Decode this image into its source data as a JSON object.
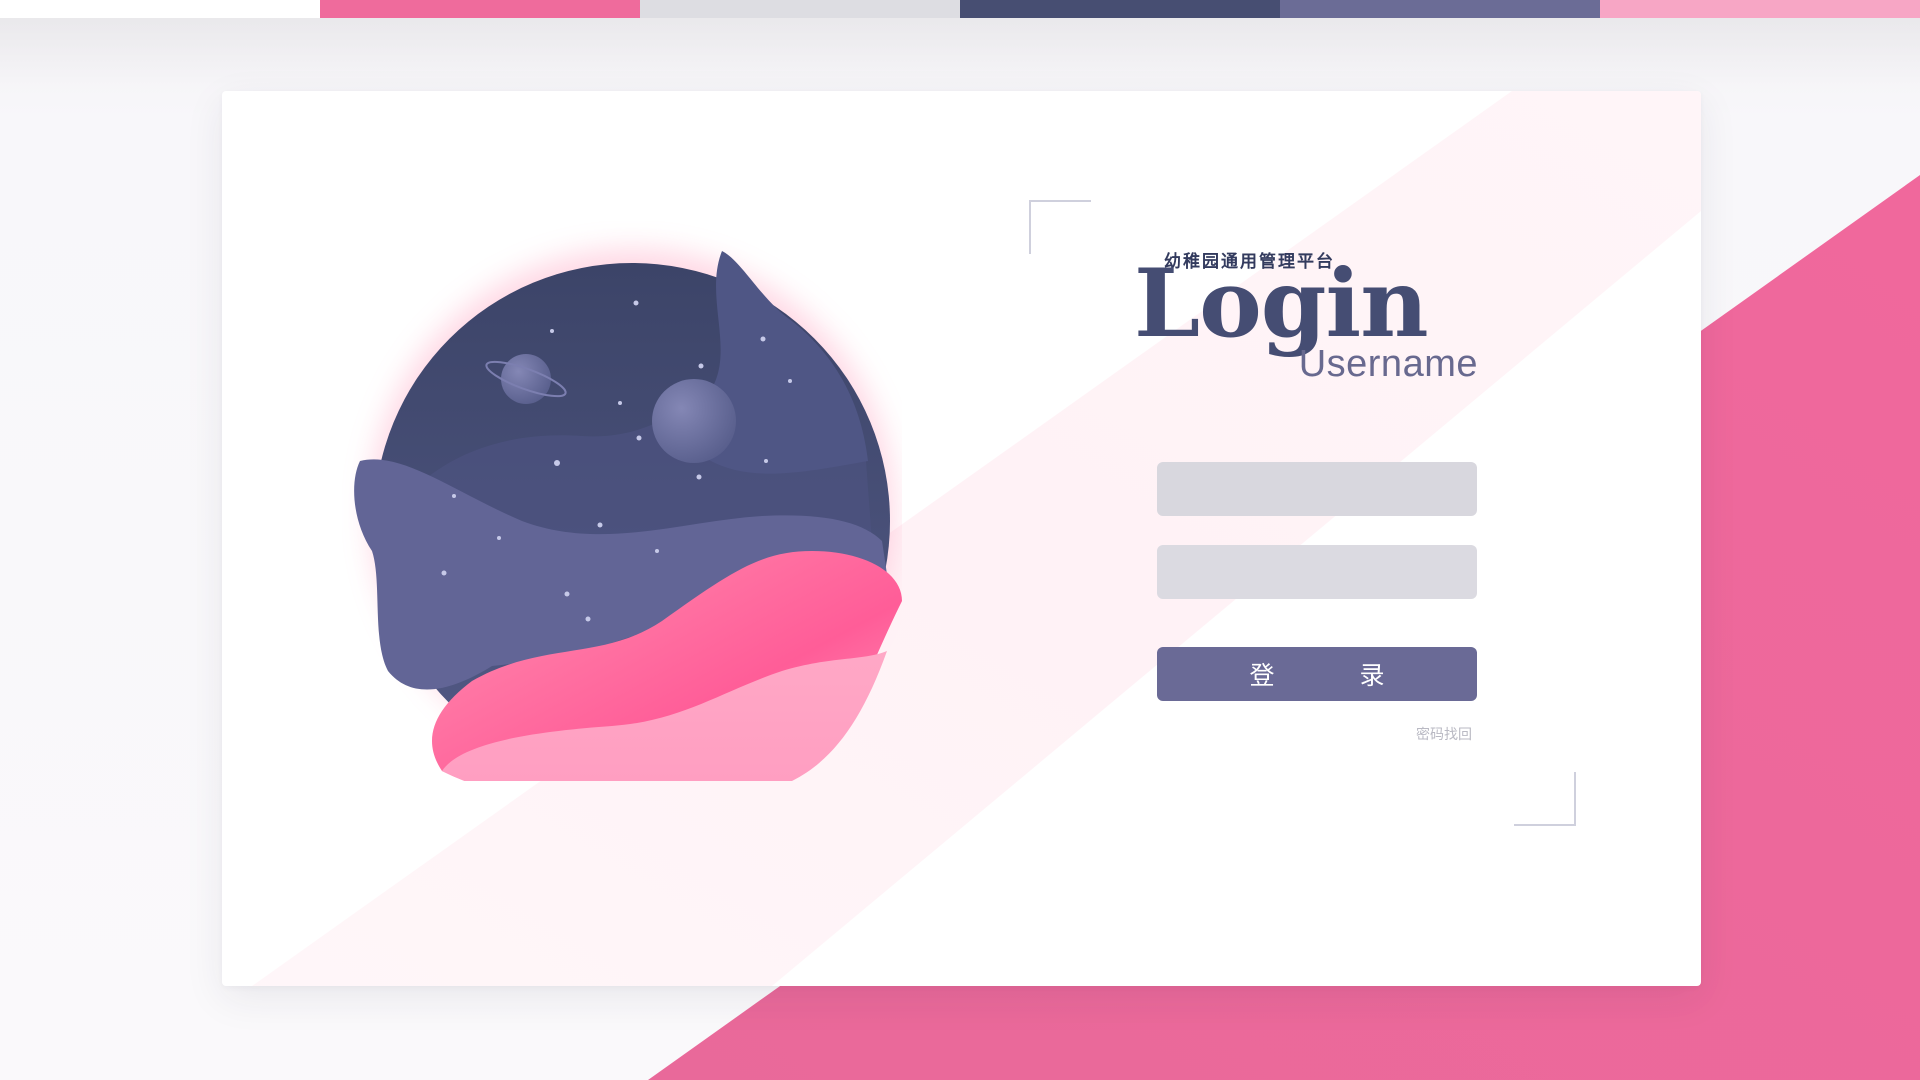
{
  "top_strip": {
    "colors": [
      "#ffffff",
      "#ef6b9c",
      "#dddde2",
      "#474e72",
      "#6b6c96",
      "#f7a6c5"
    ]
  },
  "theme": {
    "accent_pink": "#ef6b9c",
    "navy": "#454d73",
    "purple": "#6a6a96",
    "field_bg": "#d8d7de"
  },
  "login": {
    "platform_title": "幼稚园通用管理平台",
    "heading": "Login",
    "subheading": "Username",
    "username_field": {
      "value": "",
      "placeholder": ""
    },
    "password_field": {
      "value": "",
      "placeholder": ""
    },
    "submit_label": "登　录",
    "recover_link": "密码找回"
  },
  "illustration": {
    "icon": "space-wave-planet-illustration"
  }
}
